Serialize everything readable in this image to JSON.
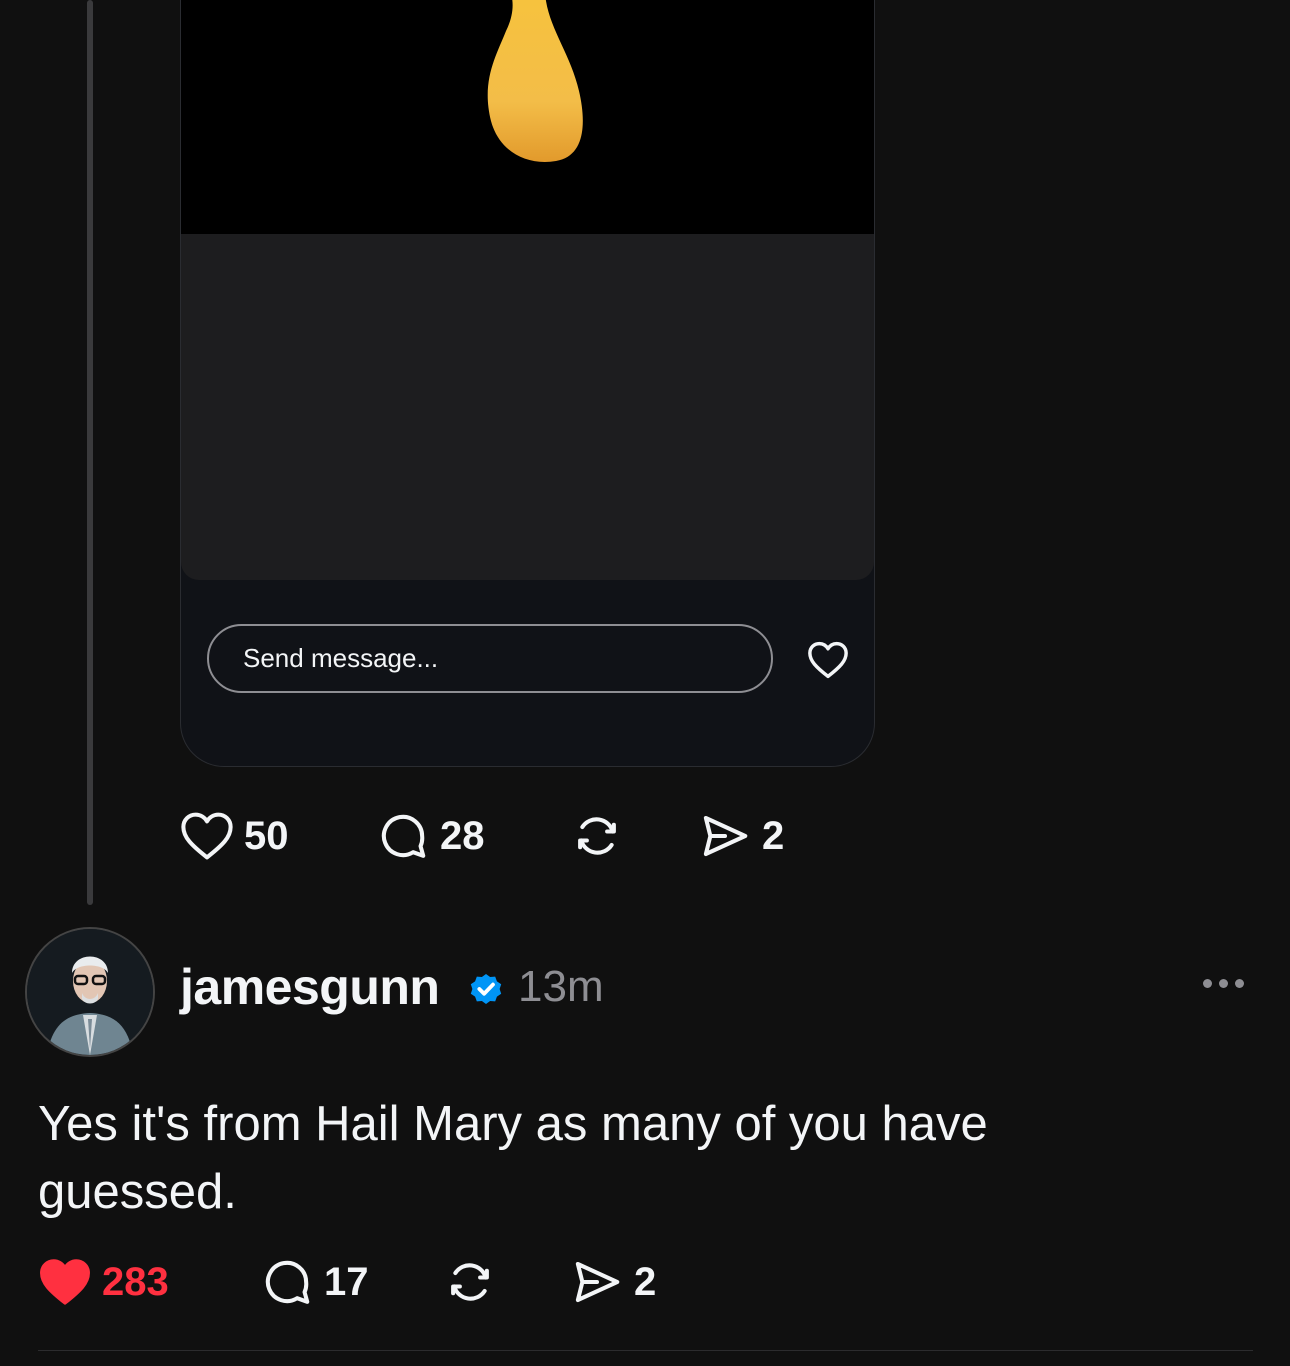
{
  "colors": {
    "background": "#101010",
    "text_primary": "#f3f5f7",
    "text_secondary": "#8e8e93",
    "like_active": "#ff3040",
    "verified_badge": "#0095f6"
  },
  "story_card": {
    "message_placeholder": "Send message...",
    "heart_icon": "heart-outline-icon"
  },
  "parent_post": {
    "actions": {
      "likes": "50",
      "replies": "28",
      "shares": "2",
      "liked": false
    }
  },
  "reply_post": {
    "username": "jamesgunn",
    "verified": true,
    "timestamp": "13m",
    "text": "Yes it's from Hail Mary as many of you have guessed.",
    "actions": {
      "likes": "283",
      "replies": "17",
      "shares": "2",
      "liked": true
    }
  }
}
